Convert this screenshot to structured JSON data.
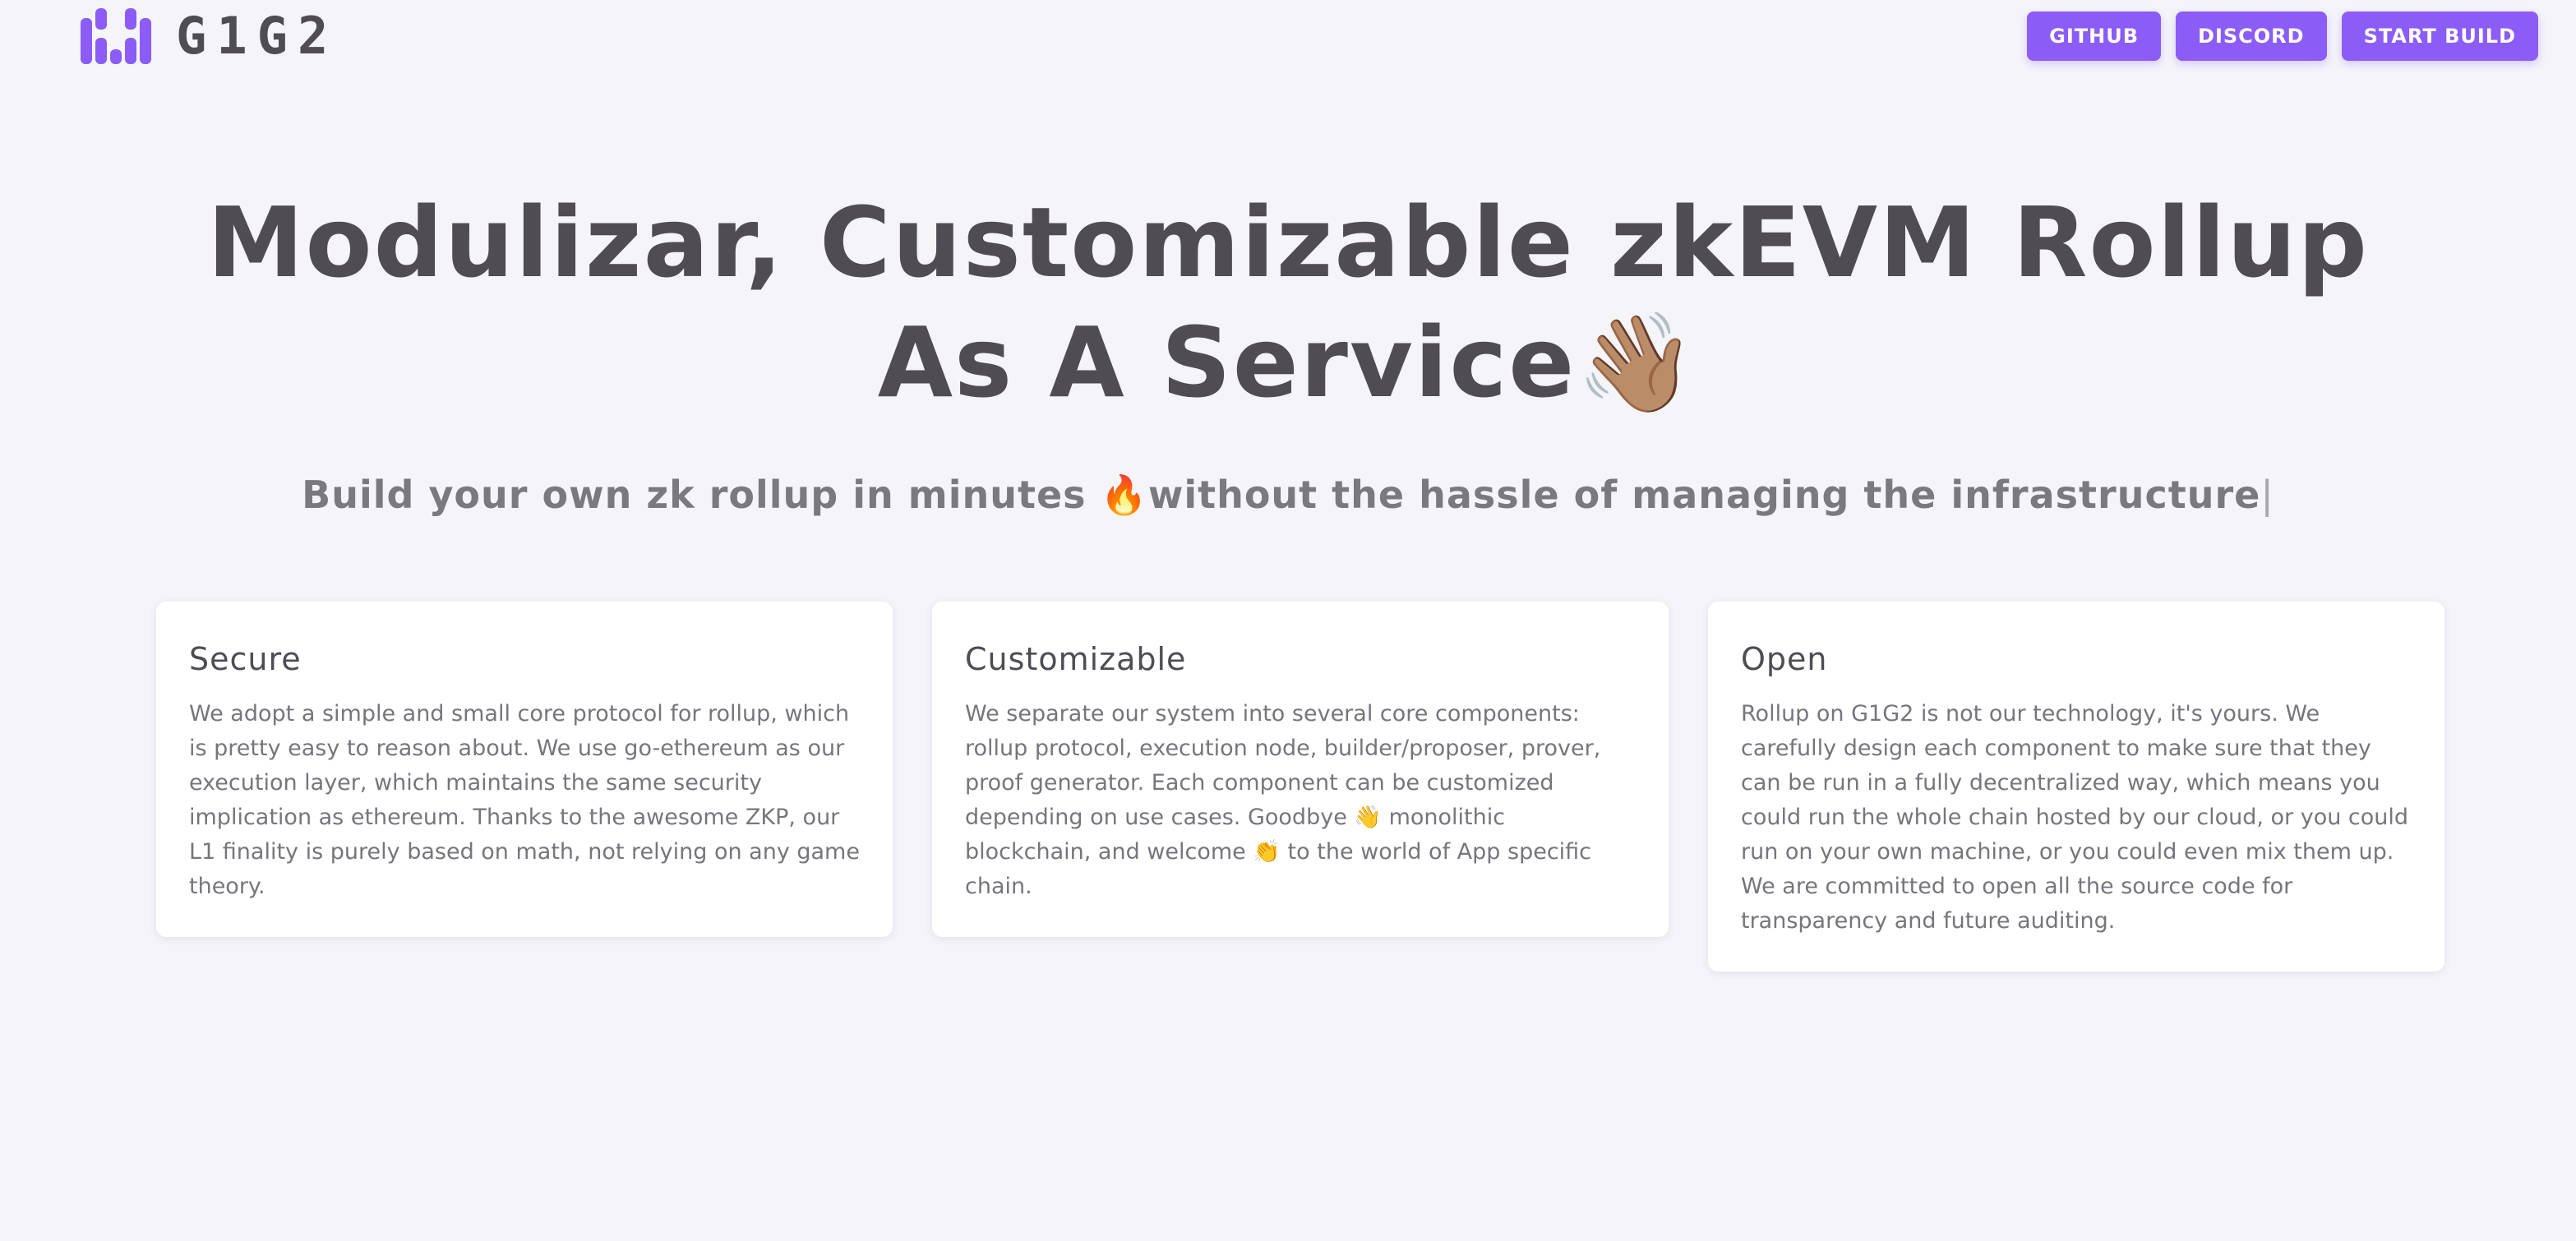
{
  "header": {
    "logo_text": "G1G2",
    "buttons": {
      "github": "GITHUB",
      "discord": "DISCORD",
      "start_build": "START BUILD"
    }
  },
  "hero": {
    "title": "Modulizar, Customizable zkEVM Rollup As A Service",
    "title_emoji": "👋🏽",
    "subtitle": "Build your own zk rollup in minutes 🔥without the hassle of managing the infrastructure",
    "cursor": "|"
  },
  "features": [
    {
      "title": "Secure",
      "body": "We adopt a simple and small core protocol for rollup, which is pretty easy to reason about. We use go-ethereum as our execution layer, which maintains the same security implication as ethereum. Thanks to the awesome ZKP, our L1 finality is purely based on math, not relying on any game theory."
    },
    {
      "title": "Customizable",
      "body": "We separate our system into several core components: rollup protocol, execution node, builder/proposer, prover, proof generator. Each component can be customized depending on use cases. Goodbye 👋 monolithic blockchain, and welcome 👏 to the world of App specific chain."
    },
    {
      "title": "Open",
      "body": "Rollup on G1G2 is not our technology, it's yours. We carefully design each component to make sure that they can be run in a fully decentralized way, which means you could run the whole chain hosted by our cloud, or you could run on your own machine, or you could even mix them up. We are committed to open all the source code for transparency and future auditing."
    }
  ],
  "colors": {
    "accent": "#8b5cf6",
    "background": "#f4f4f9",
    "heading": "#4f4c54",
    "body_text": "#77757c"
  },
  "icons": {
    "logo": "g1g2-logo-icon"
  }
}
